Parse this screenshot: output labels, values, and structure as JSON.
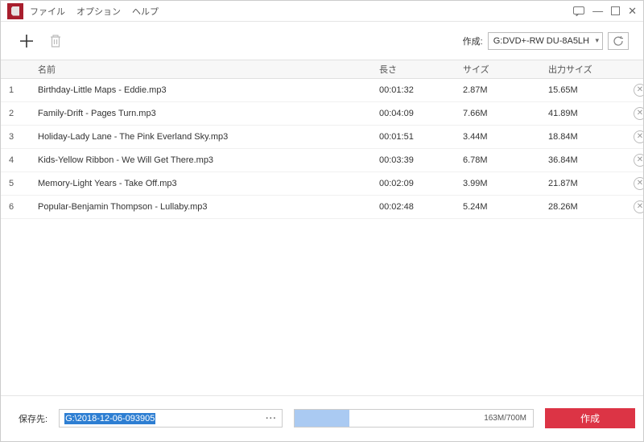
{
  "menu": {
    "file": "ファイル",
    "options": "オプション",
    "help": "ヘルプ"
  },
  "toolbar": {
    "dest_label": "作成:",
    "dest_value": "G:DVD+-RW DU-8A5LH"
  },
  "headers": {
    "name": "名前",
    "length": "長さ",
    "size": "サイズ",
    "out": "出力サイズ"
  },
  "rows": [
    {
      "idx": "1",
      "name": "Birthday-Little Maps - Eddie.mp3",
      "len": "00:01:32",
      "size": "2.87M",
      "out": "15.65M"
    },
    {
      "idx": "2",
      "name": "Family-Drift - Pages Turn.mp3",
      "len": "00:04:09",
      "size": "7.66M",
      "out": "41.89M"
    },
    {
      "idx": "3",
      "name": "Holiday-Lady Lane - The Pink Everland Sky.mp3",
      "len": "00:01:51",
      "size": "3.44M",
      "out": "18.84M"
    },
    {
      "idx": "4",
      "name": "Kids-Yellow Ribbon - We Will Get There.mp3",
      "len": "00:03:39",
      "size": "6.78M",
      "out": "36.84M"
    },
    {
      "idx": "5",
      "name": "Memory-Light Years - Take Off.mp3",
      "len": "00:02:09",
      "size": "3.99M",
      "out": "21.87M"
    },
    {
      "idx": "6",
      "name": "Popular-Benjamin Thompson - Lullaby.mp3",
      "len": "00:02:48",
      "size": "5.24M",
      "out": "28.26M"
    }
  ],
  "footer": {
    "save_label": "保存先:",
    "path": "G:\\2018-12-06-093905",
    "progress_text": "163M/700M",
    "progress_pct": 23,
    "create": "作成"
  }
}
